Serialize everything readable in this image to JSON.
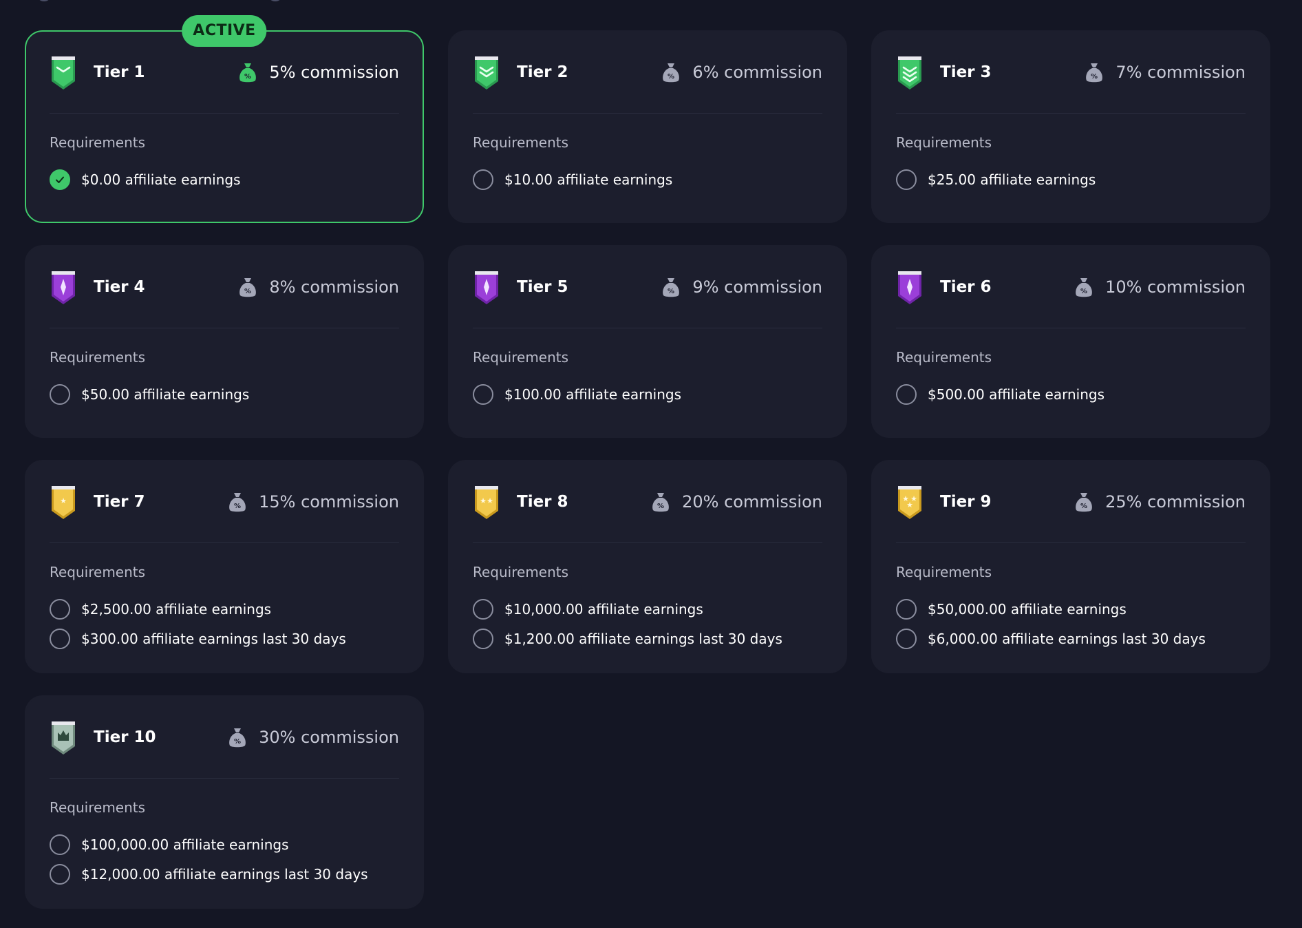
{
  "colors": {
    "background": "#141624",
    "card": "#1c1e2d",
    "active_accent": "#3fc86a",
    "green_badge": "#3fc86a",
    "purple_badge": "#9b3fd9",
    "gold_badge": "#f2c94c",
    "silver_badge": "#a9c2b6"
  },
  "requirements_label": "Requirements",
  "active_label": "ACTIVE",
  "tiers": [
    {
      "name": "Tier 1",
      "commission": "5% commission",
      "badge": "green",
      "active": true,
      "requirements": [
        {
          "text": "$0.00 affiliate earnings",
          "done": true
        }
      ]
    },
    {
      "name": "Tier 2",
      "commission": "6% commission",
      "badge": "green",
      "active": false,
      "requirements": [
        {
          "text": "$10.00 affiliate earnings",
          "done": false
        }
      ]
    },
    {
      "name": "Tier 3",
      "commission": "7% commission",
      "badge": "green",
      "active": false,
      "requirements": [
        {
          "text": "$25.00 affiliate earnings",
          "done": false
        }
      ]
    },
    {
      "name": "Tier 4",
      "commission": "8% commission",
      "badge": "purple",
      "active": false,
      "requirements": [
        {
          "text": "$50.00 affiliate earnings",
          "done": false
        }
      ]
    },
    {
      "name": "Tier 5",
      "commission": "9% commission",
      "badge": "purple",
      "active": false,
      "requirements": [
        {
          "text": "$100.00 affiliate earnings",
          "done": false
        }
      ]
    },
    {
      "name": "Tier 6",
      "commission": "10% commission",
      "badge": "purple",
      "active": false,
      "requirements": [
        {
          "text": "$500.00 affiliate earnings",
          "done": false
        }
      ]
    },
    {
      "name": "Tier 7",
      "commission": "15% commission",
      "badge": "gold",
      "active": false,
      "requirements": [
        {
          "text": "$2,500.00 affiliate earnings",
          "done": false
        },
        {
          "text": "$300.00 affiliate earnings last 30 days",
          "done": false
        }
      ]
    },
    {
      "name": "Tier 8",
      "commission": "20% commission",
      "badge": "gold",
      "active": false,
      "requirements": [
        {
          "text": "$10,000.00 affiliate earnings",
          "done": false
        },
        {
          "text": "$1,200.00 affiliate earnings last 30 days",
          "done": false
        }
      ]
    },
    {
      "name": "Tier 9",
      "commission": "25% commission",
      "badge": "gold",
      "active": false,
      "requirements": [
        {
          "text": "$50,000.00 affiliate earnings",
          "done": false
        },
        {
          "text": "$6,000.00 affiliate earnings last 30 days",
          "done": false
        }
      ]
    },
    {
      "name": "Tier 10",
      "commission": "30% commission",
      "badge": "silver",
      "active": false,
      "requirements": [
        {
          "text": "$100,000.00 affiliate earnings",
          "done": false
        },
        {
          "text": "$12,000.00 affiliate earnings last 30 days",
          "done": false
        }
      ]
    }
  ]
}
